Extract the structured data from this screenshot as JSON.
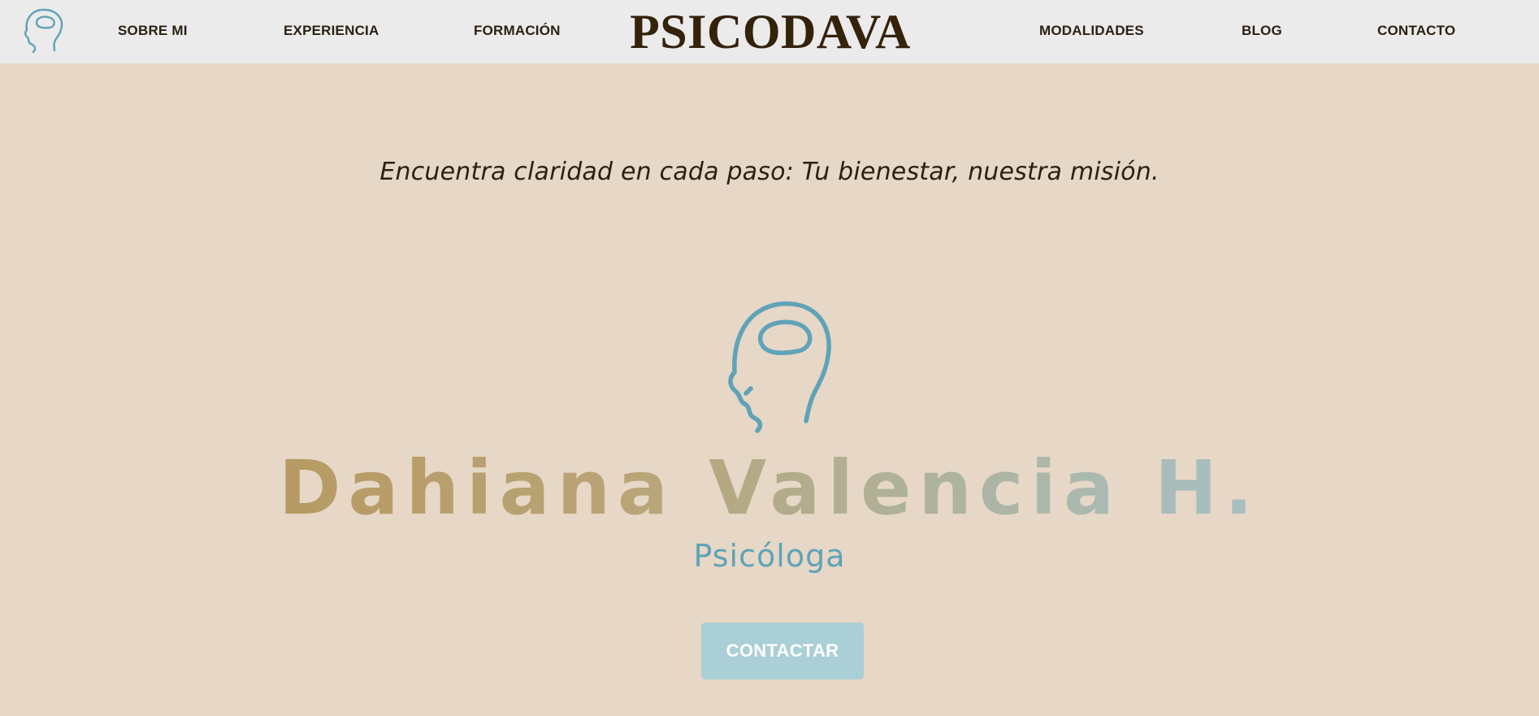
{
  "header": {
    "brand": "PSICODAVA",
    "logo_icon": "head-brain-icon",
    "nav_left": [
      {
        "label": "SOBRE MI"
      },
      {
        "label": "EXPERIENCIA"
      },
      {
        "label": "FORMACIÓN"
      }
    ],
    "nav_right": [
      {
        "label": "MODALIDADES"
      },
      {
        "label": "BLOG"
      },
      {
        "label": "CONTACTO"
      }
    ]
  },
  "hero": {
    "tagline": "Encuentra claridad en cada paso: Tu bienestar, nuestra misión.",
    "logo_icon": "head-brain-icon",
    "name": "Dahiana Valencia H.",
    "subtitle": "Psicóloga",
    "cta_label": "CONTACTAR"
  },
  "colors": {
    "header_bg": "#ebebeb",
    "page_bg": "#e6d7c7",
    "text_dark": "#2b2013",
    "brand_dark": "#34220b",
    "accent_blue": "#5fa3b7",
    "button_bg": "#aacfd6",
    "name_gold": "#b79a63"
  }
}
